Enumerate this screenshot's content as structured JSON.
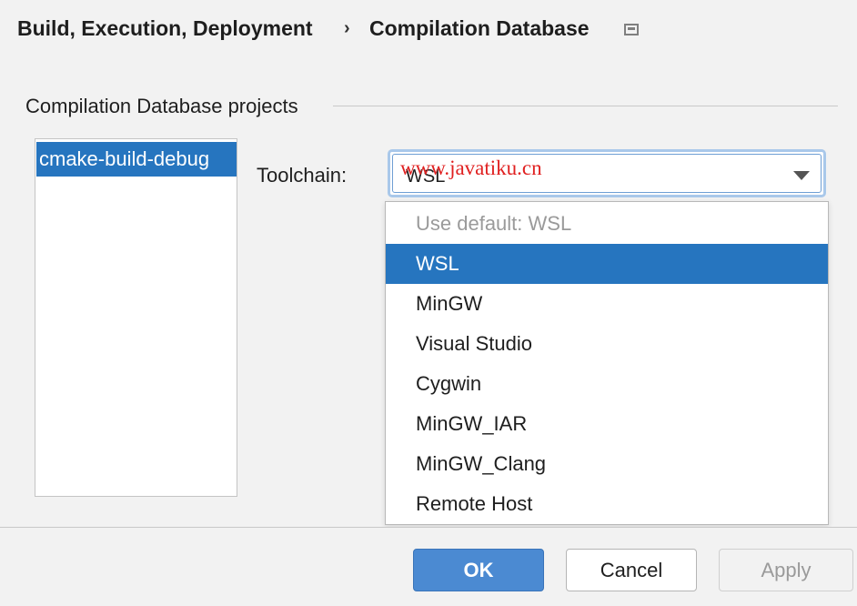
{
  "breadcrumb": {
    "parent": "Build, Execution, Deployment",
    "separator": "›",
    "current": "Compilation Database"
  },
  "section": {
    "title": "Compilation Database projects"
  },
  "projects": {
    "items": [
      "cmake-build-debug"
    ],
    "selected": "cmake-build-debug"
  },
  "toolchain": {
    "label": "Toolchain:",
    "value": "WSL",
    "options": [
      {
        "label": "Use default: WSL",
        "state": "disabled"
      },
      {
        "label": "WSL",
        "state": "selected"
      },
      {
        "label": "MinGW",
        "state": "normal"
      },
      {
        "label": "Visual Studio",
        "state": "normal"
      },
      {
        "label": "Cygwin",
        "state": "normal"
      },
      {
        "label": "MinGW_IAR",
        "state": "normal"
      },
      {
        "label": "MinGW_Clang",
        "state": "normal"
      },
      {
        "label": "Remote Host",
        "state": "normal"
      }
    ]
  },
  "watermark": "www.javatiku.cn",
  "buttons": {
    "ok": "OK",
    "cancel": "Cancel",
    "apply": "Apply"
  },
  "colors": {
    "selection": "#2675bf",
    "ok_button": "#4b8ad2",
    "watermark": "#e02020"
  }
}
